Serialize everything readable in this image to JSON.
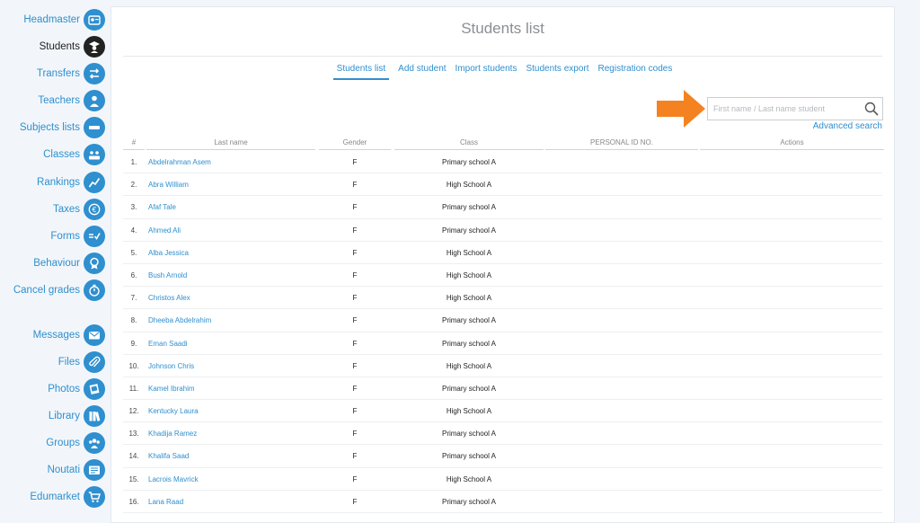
{
  "sidebar": {
    "items": [
      {
        "label": "Headmaster",
        "icon": "person-card-icon",
        "active": false
      },
      {
        "label": "Students",
        "icon": "graduate-icon",
        "active": true
      },
      {
        "label": "Transfers",
        "icon": "transfer-arrows-icon",
        "active": false
      },
      {
        "label": "Teachers",
        "icon": "teacher-icon",
        "active": false
      },
      {
        "label": "Subjects lists",
        "icon": "list-bars-icon",
        "active": false
      },
      {
        "label": "Classes",
        "icon": "classroom-icon",
        "active": false
      },
      {
        "label": "Rankings",
        "icon": "trend-chart-icon",
        "active": false
      },
      {
        "label": "Taxes",
        "icon": "euro-icon",
        "active": false
      },
      {
        "label": "Forms",
        "icon": "form-check-icon",
        "active": false
      },
      {
        "label": "Behaviour",
        "icon": "award-ribbon-icon",
        "active": false
      },
      {
        "label": "Cancel grades",
        "icon": "stopwatch-icon",
        "active": false
      },
      {
        "label": "Messages",
        "icon": "envelope-icon",
        "active": false
      },
      {
        "label": "Files",
        "icon": "paperclip-icon",
        "active": false
      },
      {
        "label": "Photos",
        "icon": "photos-icon",
        "active": false
      },
      {
        "label": "Library",
        "icon": "books-icon",
        "active": false
      },
      {
        "label": "Groups",
        "icon": "group-icon",
        "active": false
      },
      {
        "label": "Noutati",
        "icon": "news-icon",
        "active": false
      },
      {
        "label": "Edumarket",
        "icon": "cart-icon",
        "active": false
      }
    ]
  },
  "page": {
    "title": "Students list",
    "tabs": [
      "Students list",
      "Add student",
      "Import students",
      "Students export",
      "Registration codes"
    ],
    "active_tab": 0
  },
  "search": {
    "placeholder": "First name / Last name student",
    "value": "",
    "advanced_label": "Advanced search"
  },
  "table": {
    "headers": [
      "#",
      "Last name",
      "Gender",
      "Class",
      "PERSONAL ID NO.",
      "Actions"
    ],
    "rows": [
      {
        "num": "1.",
        "name": "Abdelrahman Asem",
        "gender": "F",
        "class": "Primary school A"
      },
      {
        "num": "2.",
        "name": "Abra William",
        "gender": "F",
        "class": "High School A"
      },
      {
        "num": "3.",
        "name": "Afaf Tale",
        "gender": "F",
        "class": "Primary school A"
      },
      {
        "num": "4.",
        "name": "Ahmed Ali",
        "gender": "F",
        "class": "Primary school A"
      },
      {
        "num": "5.",
        "name": "Alba Jessica",
        "gender": "F",
        "class": "High School A"
      },
      {
        "num": "6.",
        "name": "Bush Arnold",
        "gender": "F",
        "class": "High School A"
      },
      {
        "num": "7.",
        "name": "Christos Alex",
        "gender": "F",
        "class": "High School A"
      },
      {
        "num": "8.",
        "name": "Dheeba Abdelrahim",
        "gender": "F",
        "class": "Primary school A"
      },
      {
        "num": "9.",
        "name": "Eman Saadi",
        "gender": "F",
        "class": "Primary school A"
      },
      {
        "num": "10.",
        "name": "Johnson Chris",
        "gender": "F",
        "class": "High School A"
      },
      {
        "num": "11.",
        "name": "Kamel Ibrahim",
        "gender": "F",
        "class": "Primary school A"
      },
      {
        "num": "12.",
        "name": "Kentucky Laura",
        "gender": "F",
        "class": "High School A"
      },
      {
        "num": "13.",
        "name": "Khadija Ramez",
        "gender": "F",
        "class": "Primary school A"
      },
      {
        "num": "14.",
        "name": "Khalifa Saad",
        "gender": "F",
        "class": "Primary school A"
      },
      {
        "num": "15.",
        "name": "Lacrois Mavrick",
        "gender": "F",
        "class": "High School A"
      },
      {
        "num": "16.",
        "name": "Lana Raad",
        "gender": "F",
        "class": "Primary school A"
      }
    ]
  },
  "colors": {
    "accent": "#2f8fcf",
    "active_icon": "#222222",
    "arrow": "#f58220",
    "background": "#f2f6fa"
  }
}
